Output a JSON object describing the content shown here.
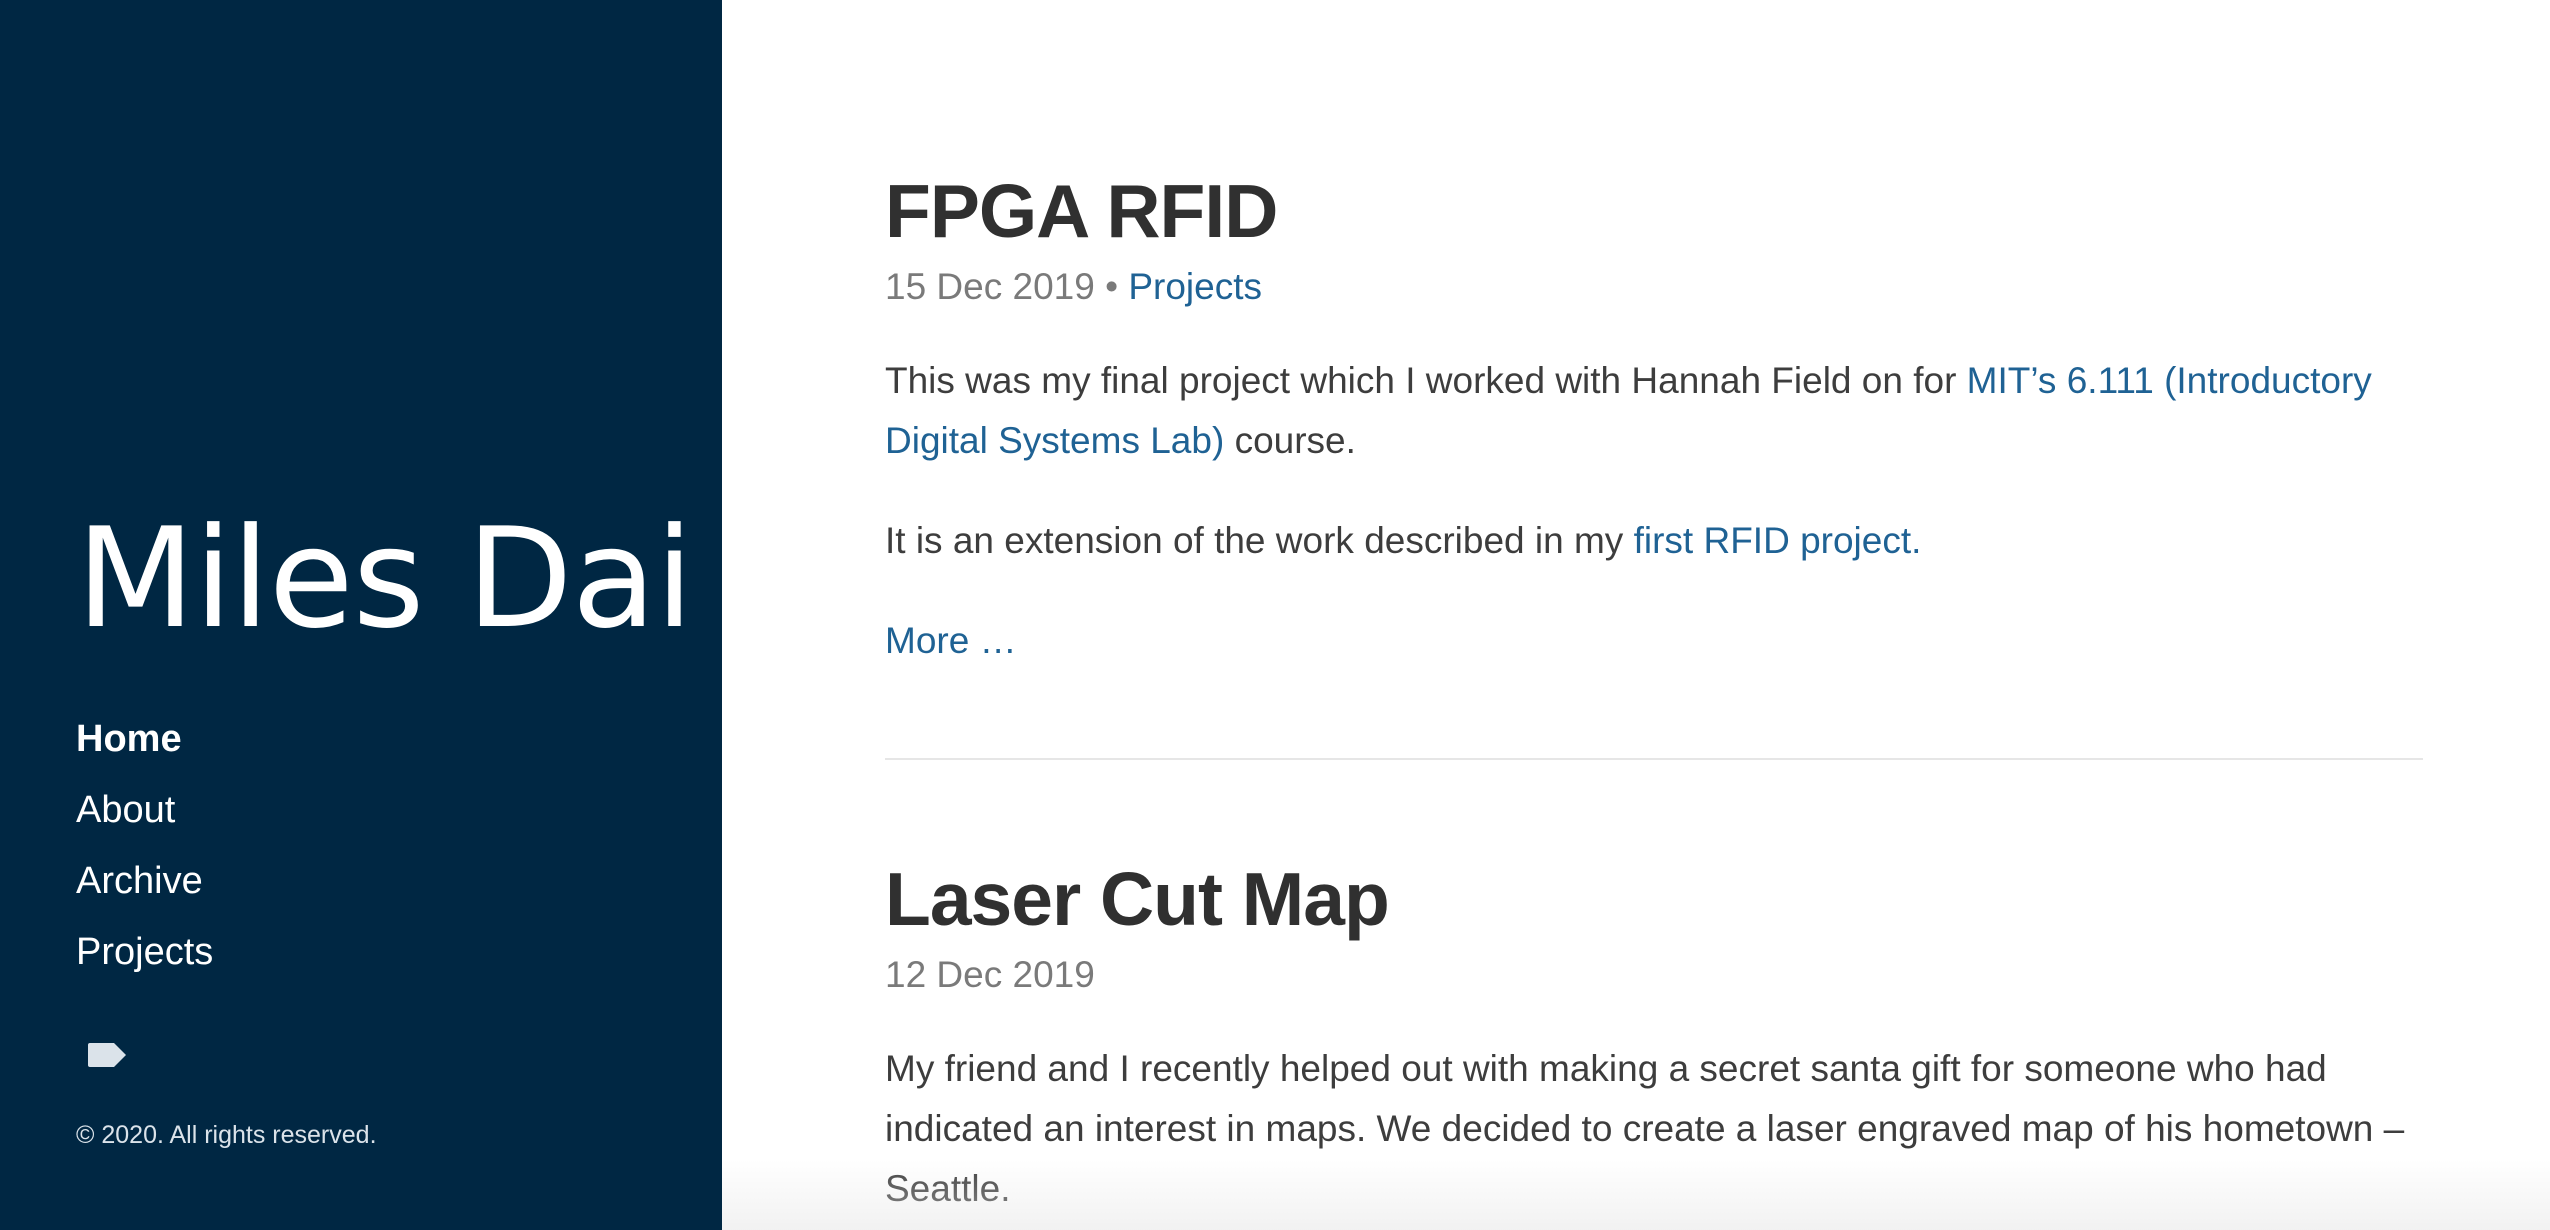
{
  "sidebar": {
    "site_title": "Miles Dai",
    "nav": [
      {
        "label": "Home",
        "active": true
      },
      {
        "label": "About",
        "active": false
      },
      {
        "label": "Archive",
        "active": false
      },
      {
        "label": "Projects",
        "active": false
      }
    ],
    "tag_icon": "tag-icon",
    "copyright": "© 2020. All rights reserved."
  },
  "posts": [
    {
      "title": "FPGA RFID",
      "date": "15 Dec 2019",
      "separator": "•",
      "category": "Projects",
      "p1_text_a": "This was my final project which I worked with Hannah Field on for ",
      "p1_link": "MIT’s 6.111 (Introductory Digital Systems Lab)",
      "p1_text_b": " course.",
      "p2_text_a": "It is an extension of the work described in my ",
      "p2_link": "first RFID project.",
      "more": "More …"
    },
    {
      "title": "Laser Cut Map",
      "date": "12 Dec 2019",
      "p1_text": "My friend and I recently helped out with making a secret santa gift for someone who had indicated an interest in maps. We decided to create a laser engraved map of his hometown – Seattle."
    }
  ],
  "colors": {
    "sidebar_bg": "#002743",
    "link": "#1f6294",
    "text": "#3d3d3d",
    "meta": "#7a7a7a"
  }
}
